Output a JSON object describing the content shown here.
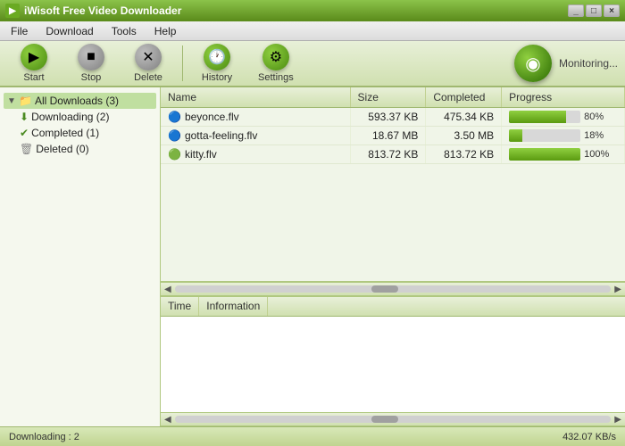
{
  "titleBar": {
    "title": "iWisoft Free Video Downloader",
    "controls": [
      "_",
      "□",
      "×"
    ]
  },
  "menuBar": {
    "items": [
      "File",
      "Download",
      "Tools",
      "Help"
    ]
  },
  "toolbar": {
    "buttons": [
      {
        "id": "start",
        "label": "Start",
        "icon": "▶",
        "style": "green"
      },
      {
        "id": "stop",
        "label": "Stop",
        "icon": "■",
        "style": "gray"
      },
      {
        "id": "delete",
        "label": "Delete",
        "icon": "✕",
        "style": "gray"
      },
      {
        "id": "history",
        "label": "History",
        "icon": "🕐",
        "style": "green"
      },
      {
        "id": "settings",
        "label": "Settings",
        "icon": "⚙",
        "style": "green"
      }
    ],
    "monitoring": {
      "label": "Monitoring...",
      "icon": "◉"
    }
  },
  "sidebar": {
    "tree": [
      {
        "id": "all",
        "label": "All Downloads (3)",
        "icon": "folder",
        "expanded": true,
        "level": 0
      },
      {
        "id": "downloading",
        "label": "Downloading (2)",
        "icon": "download",
        "level": 1
      },
      {
        "id": "completed",
        "label": "Completed (1)",
        "icon": "check",
        "level": 1
      },
      {
        "id": "deleted",
        "label": "Deleted (0)",
        "icon": "trash",
        "level": 1
      }
    ]
  },
  "fileTable": {
    "columns": [
      "Name",
      "Size",
      "Completed",
      "Progress"
    ],
    "rows": [
      {
        "id": 1,
        "name": "beyonce.flv",
        "size": "593.37 KB",
        "completed": "475.34 KB",
        "progress": 80,
        "progressLabel": "80%",
        "icon": "🔵",
        "status": "downloading"
      },
      {
        "id": 2,
        "name": "gotta-feeling.flv",
        "size": "18.67 MB",
        "completed": "3.50 MB",
        "progress": 18,
        "progressLabel": "18%",
        "icon": "🔵",
        "status": "downloading"
      },
      {
        "id": 3,
        "name": "kitty.flv",
        "size": "813.72 KB",
        "completed": "813.72 KB",
        "progress": 100,
        "progressLabel": "100%",
        "icon": "🟢",
        "status": "completed"
      }
    ]
  },
  "infoPane": {
    "columns": [
      "Time",
      "Information"
    ]
  },
  "statusBar": {
    "downloading_label": "Downloading : 2",
    "speed_label": "432.07 KB/s"
  }
}
